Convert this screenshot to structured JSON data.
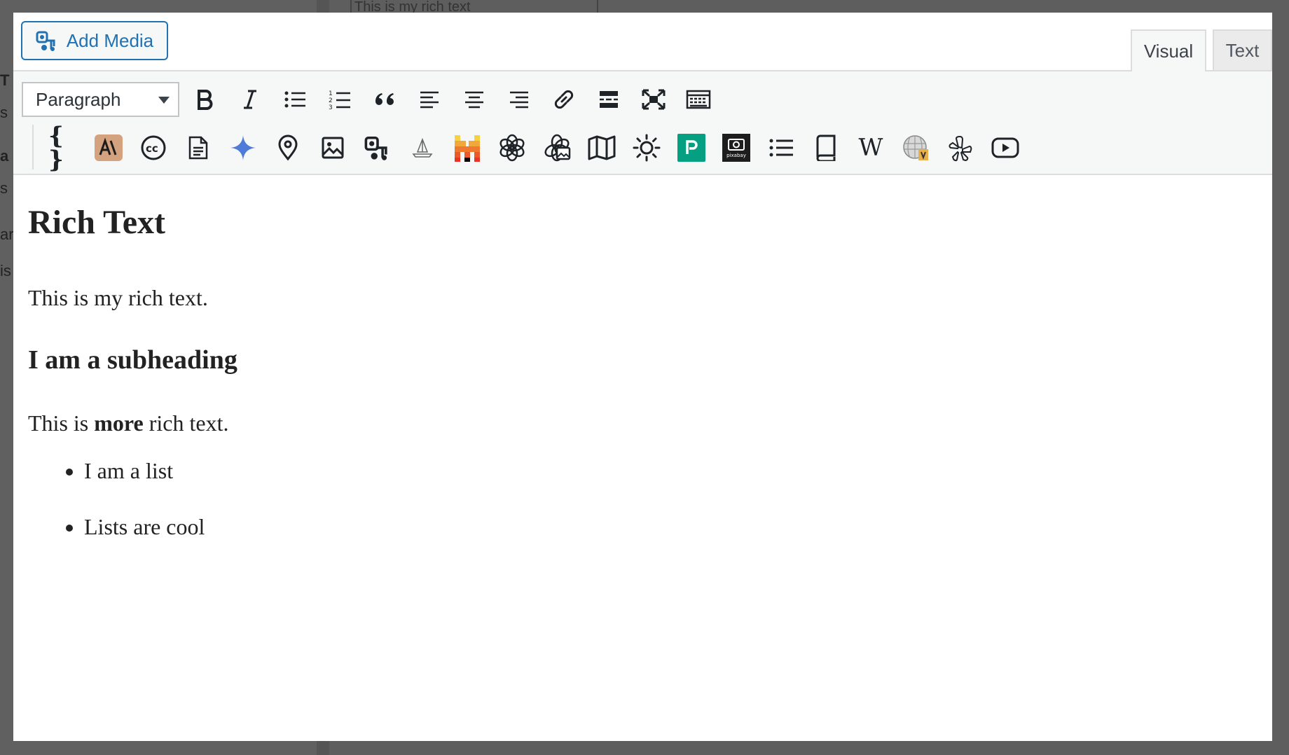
{
  "background": {
    "behind_text": "This is my rich text",
    "left_letters": [
      "T",
      "s",
      "a",
      "s",
      "ar",
      "is"
    ]
  },
  "topbar": {
    "add_media_label": "Add Media",
    "add_media_icon": "media-icon"
  },
  "tabs": {
    "visual": "Visual",
    "text": "Text"
  },
  "toolbar": {
    "format_value": "Paragraph",
    "row1": [
      "bold-icon",
      "italic-icon",
      "bullet-list-icon",
      "numbered-list-icon",
      "blockquote-icon",
      "align-left-icon",
      "align-center-icon",
      "align-right-icon",
      "link-icon",
      "read-more-icon",
      "fullscreen-icon",
      "toolbar-toggle-icon"
    ],
    "row2": [
      "code-braces-icon",
      "anthropic-icon",
      "creative-commons-icon",
      "document-icon",
      "gemini-sparkle-icon",
      "map-pin-icon",
      "image-icon",
      "media-icon",
      "ship-icon",
      "mistral-icon",
      "openai-icon",
      "openai-image-icon",
      "map-icon",
      "sun-icon",
      "pexels-icon",
      "pixabay-icon",
      "list-icon",
      "book-icon",
      "wikipedia-icon",
      "wikipedia-globe-icon",
      "yelp-icon",
      "youtube-icon"
    ],
    "pixabay_text": "pixabay",
    "wikipedia_text": "W"
  },
  "content": {
    "heading": "Rich Text",
    "paragraph1": "This is my rich text.",
    "subheading": "I am a subheading",
    "paragraph2_before": "This is ",
    "paragraph2_bold": "more",
    "paragraph2_after": " rich text.",
    "list": [
      "I am a list",
      "Lists are cool"
    ]
  },
  "colors": {
    "accent": "#2271b1",
    "anthropic_bg": "#d4a27f",
    "pexels": "#05a081",
    "gemini": "#4f7bd8"
  }
}
